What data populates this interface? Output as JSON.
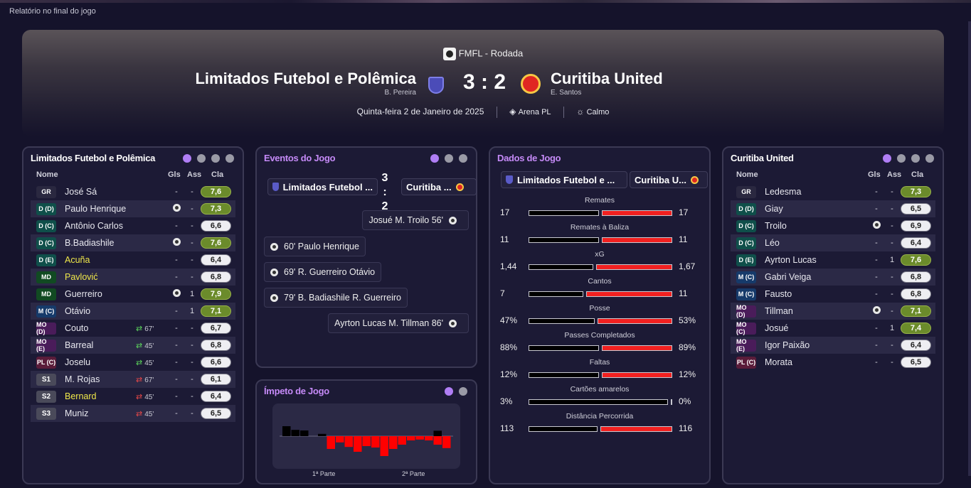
{
  "window": {
    "title": "Relatório no final do jogo"
  },
  "header": {
    "competition": "FMFL - Rodada",
    "home": {
      "name": "Limitados Futebol e Polêmica",
      "coach": "B. Pereira"
    },
    "away": {
      "name": "Curitiba United",
      "coach": "E. Santos"
    },
    "score": "3 : 2",
    "date": "Quinta-feira 2 de Janeiro de 2025",
    "stadium": "Arena PL",
    "weather": "Calmo"
  },
  "home_panel": {
    "title": "Limitados Futebol e Polêmica",
    "headers": {
      "name": "Nome",
      "goals": "Gls",
      "assists": "Ass",
      "rating": "Cla"
    },
    "players": [
      {
        "pos": "GR",
        "name": "José Sá",
        "goals": "-",
        "assists": "-",
        "rating": "7,6",
        "good": true
      },
      {
        "pos": "D (D)",
        "name": "Paulo Henrique",
        "goals": "ball",
        "assists": "-",
        "rating": "7,3",
        "good": true
      },
      {
        "pos": "D (C)",
        "name": "Antônio Carlos",
        "goals": "-",
        "assists": "-",
        "rating": "6,6"
      },
      {
        "pos": "D (C)",
        "name": "B.Badiashile",
        "goals": "ball",
        "assists": "-",
        "rating": "7,6",
        "good": true
      },
      {
        "pos": "D (E)",
        "name": "Acuña",
        "goals": "-",
        "assists": "-",
        "rating": "6,4",
        "yellow": true
      },
      {
        "pos": "MD",
        "name": "Pavlović",
        "goals": "-",
        "assists": "-",
        "rating": "6,8",
        "yellow": true
      },
      {
        "pos": "MD",
        "name": "Guerreiro",
        "goals": "ball",
        "assists": "1",
        "rating": "7,9",
        "good": true
      },
      {
        "pos": "M (C)",
        "name": "Otávio",
        "goals": "-",
        "assists": "1",
        "rating": "7,1",
        "good": true
      },
      {
        "pos": "MO (D)",
        "name": "Couto",
        "sub": "67'",
        "subdir": "in",
        "goals": "-",
        "assists": "-",
        "rating": "6,7"
      },
      {
        "pos": "MO (E)",
        "name": "Barreal",
        "sub": "45'",
        "subdir": "in",
        "goals": "-",
        "assists": "-",
        "rating": "6,8"
      },
      {
        "pos": "PL (C)",
        "name": "Joselu",
        "sub": "45'",
        "subdir": "in",
        "goals": "-",
        "assists": "-",
        "rating": "6,6"
      },
      {
        "pos": "S1",
        "name": "M. Rojas",
        "sub": "67'",
        "subdir": "out",
        "goals": "-",
        "assists": "-",
        "rating": "6,1"
      },
      {
        "pos": "S2",
        "name": "Bernard",
        "sub": "45'",
        "subdir": "out",
        "goals": "-",
        "assists": "-",
        "rating": "6,4",
        "yellow": true
      },
      {
        "pos": "S3",
        "name": "Muniz",
        "sub": "45'",
        "subdir": "out",
        "goals": "-",
        "assists": "-",
        "rating": "6,5"
      }
    ]
  },
  "away_panel": {
    "title": "Curitiba United",
    "headers": {
      "name": "Nome",
      "goals": "Gls",
      "assists": "Ass",
      "rating": "Cla"
    },
    "players": [
      {
        "pos": "GR",
        "name": "Ledesma",
        "goals": "-",
        "assists": "-",
        "rating": "7,3",
        "good": true
      },
      {
        "pos": "D (D)",
        "name": "Giay",
        "goals": "-",
        "assists": "-",
        "rating": "6,5"
      },
      {
        "pos": "D (C)",
        "name": "Troilo",
        "goals": "ball",
        "assists": "-",
        "rating": "6,9"
      },
      {
        "pos": "D (C)",
        "name": "Léo",
        "goals": "-",
        "assists": "-",
        "rating": "6,4"
      },
      {
        "pos": "D (E)",
        "name": "Ayrton Lucas",
        "goals": "-",
        "assists": "1",
        "rating": "7,6",
        "good": true
      },
      {
        "pos": "M (C)",
        "name": "Gabri Veiga",
        "goals": "-",
        "assists": "-",
        "rating": "6,8"
      },
      {
        "pos": "M (C)",
        "name": "Fausto",
        "goals": "-",
        "assists": "-",
        "rating": "6,8"
      },
      {
        "pos": "MO (D)",
        "name": "Tillman",
        "goals": "ball",
        "assists": "-",
        "rating": "7,1",
        "good": true
      },
      {
        "pos": "MO (C)",
        "name": "Josué",
        "goals": "-",
        "assists": "1",
        "rating": "7,4",
        "good": true
      },
      {
        "pos": "MO (E)",
        "name": "Igor Paixão",
        "goals": "-",
        "assists": "-",
        "rating": "6,4"
      },
      {
        "pos": "PL (C)",
        "name": "Morata",
        "goals": "-",
        "assists": "-",
        "rating": "6,5"
      }
    ]
  },
  "events_panel": {
    "title": "Eventos do Jogo",
    "home_team": "Limitados Futebol ...",
    "away_team": "Curitiba ...",
    "score_top": "3 :",
    "score_bottom": "2",
    "events": [
      {
        "side": "away",
        "text": "Josué  M. Troilo  56'"
      },
      {
        "side": "home",
        "text": "60'  Paulo Henrique"
      },
      {
        "side": "home",
        "text": "69'  R. Guerreiro  Otávio"
      },
      {
        "side": "home",
        "text": "79'  B. Badiashile  R. Guerreiro"
      },
      {
        "side": "away",
        "text": "Ayrton Lucas  M. Tillman  86'"
      }
    ]
  },
  "momentum_panel": {
    "title": "Ímpeto de Jogo",
    "label_first": "1ª Parte",
    "label_second": "2ª Parte"
  },
  "stats_panel": {
    "title": "Dados de Jogo",
    "home_team": "Limitados Futebol e ...",
    "away_team": "Curitiba U...",
    "stats": [
      {
        "label": "Remates",
        "home": "17",
        "away": "17",
        "home_frac": 0.5
      },
      {
        "label": "Remates à Baliza",
        "home": "11",
        "away": "11",
        "home_frac": 0.5
      },
      {
        "label": "xG",
        "home": "1,44",
        "away": "1,67",
        "home_frac": 0.46
      },
      {
        "label": "Cantos",
        "home": "7",
        "away": "11",
        "home_frac": 0.39
      },
      {
        "label": "Posse",
        "home": "47%",
        "away": "53%",
        "home_frac": 0.47
      },
      {
        "label": "Passes Completados",
        "home": "88%",
        "away": "89%",
        "home_frac": 0.5
      },
      {
        "label": "Faltas",
        "home": "12%",
        "away": "12%",
        "home_frac": 0.5
      },
      {
        "label": "Cartões amarelos",
        "home": "3%",
        "away": "0%",
        "home_frac": 0.99
      },
      {
        "label": "Distância Percorrida",
        "home": "113",
        "away": "116",
        "home_frac": 0.49
      }
    ]
  },
  "colors": {
    "accent": "#b07ef5",
    "good_rating": "#6b8b2b",
    "away_bar": "#f12020",
    "home_bar": "#000000"
  },
  "chart_data": {
    "type": "bar",
    "series": [
      {
        "values": [
          0.35,
          0.22,
          0.2,
          0,
          0.08,
          0,
          0,
          0,
          0,
          0,
          0,
          0,
          0,
          0,
          0,
          0,
          0,
          0.19,
          0
        ]
      },
      {
        "values": [
          0,
          0,
          0,
          0,
          0,
          -0.45,
          -0.22,
          -0.38,
          -0.55,
          -0.35,
          -0.4,
          -0.7,
          -0.45,
          -0.3,
          -0.15,
          -0.12,
          -0.15,
          -0.3,
          -0.42
        ]
      }
    ]
  }
}
